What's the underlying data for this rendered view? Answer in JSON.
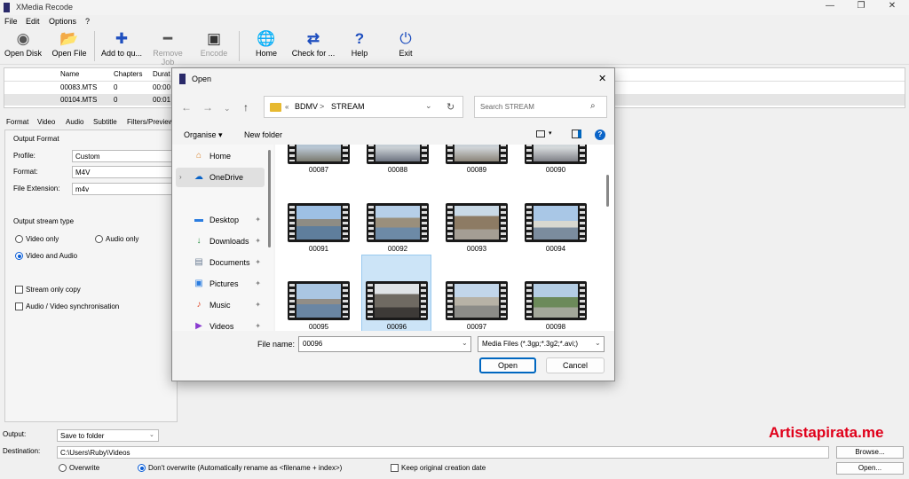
{
  "app": {
    "title": "XMedia Recode",
    "menu": [
      "File",
      "Edit",
      "Options",
      "?"
    ],
    "controls": {
      "minimize": "—",
      "maximize": "❐",
      "close": "✕"
    }
  },
  "toolbar": {
    "buttons": [
      {
        "label": "Open Disk",
        "icon": "disc-icon",
        "glyph": "◉",
        "enabled": true
      },
      {
        "label": "Open File",
        "icon": "folder-icon",
        "glyph": "📂",
        "enabled": true
      },
      {
        "label": "Add to qu...",
        "icon": "plus-icon",
        "glyph": "✚",
        "enabled": true
      },
      {
        "label": "Remove Job",
        "icon": "minus-icon",
        "glyph": "━",
        "enabled": false
      },
      {
        "label": "Encode",
        "icon": "encode-icon",
        "glyph": "▣",
        "enabled": false
      },
      {
        "label": "Home",
        "icon": "globe-icon",
        "glyph": "🌐",
        "enabled": true
      },
      {
        "label": "Check for ...",
        "icon": "refresh-icon",
        "glyph": "⇄",
        "enabled": true
      },
      {
        "label": "Help",
        "icon": "help-icon",
        "glyph": "?",
        "enabled": true
      },
      {
        "label": "Exit",
        "icon": "power-icon",
        "glyph": "⏻",
        "enabled": true
      }
    ]
  },
  "jobs": {
    "headers": [
      "Name",
      "Chapters",
      "Durat"
    ],
    "rows": [
      [
        "00083.MTS",
        "0",
        "00:00"
      ],
      [
        "00104.MTS",
        "0",
        "00:01"
      ]
    ]
  },
  "tabs": [
    "Format",
    "Video",
    "Audio",
    "Subtitle",
    "Filters/Preview"
  ],
  "format": {
    "group_title": "Output Format",
    "profile_label": "Profile:",
    "profile_value": "Custom",
    "format_label": "Format:",
    "format_value": "M4V",
    "ext_label": "File Extension:",
    "ext_value": "m4v",
    "stream_type_title": "Output stream type",
    "video_only": "Video only",
    "audio_only": "Audio only",
    "video_and_audio": "Video and Audio",
    "stream_copy": "Stream only copy",
    "av_sync": "Audio / Video synchronisation"
  },
  "bottom": {
    "output_label": "Output:",
    "output_value": "Save to folder",
    "destination_label": "Destination:",
    "destination_value": "C:\\Users\\Ruby\\Videos",
    "browse": "Browse...",
    "open": "Open...",
    "overwrite": "Overwrite",
    "dont_overwrite": "Don't overwrite (Automatically rename as <filename + index>)",
    "keep_date": "Keep original creation date"
  },
  "dialog": {
    "title": "Open",
    "close": "✕",
    "path": [
      "«",
      "BDMV",
      ">",
      "STREAM"
    ],
    "search_placeholder": "Search STREAM",
    "organise": "Organise ▾",
    "new_folder": "New folder",
    "nav": [
      {
        "label": "Home",
        "icon": "home-icon",
        "glyph": "⌂",
        "pin": false,
        "color": "#d9822b"
      },
      {
        "label": "OneDrive",
        "icon": "cloud-icon",
        "glyph": "☁",
        "pin": false,
        "color": "#0a64c8"
      },
      {
        "label": "Desktop",
        "icon": "desktop-icon",
        "glyph": "▬",
        "pin": true,
        "color": "#2b7de0"
      },
      {
        "label": "Downloads",
        "icon": "download-icon",
        "glyph": "↓",
        "pin": true,
        "color": "#1e8a3b"
      },
      {
        "label": "Documents",
        "icon": "documents-icon",
        "glyph": "▤",
        "pin": true,
        "color": "#6b7c93"
      },
      {
        "label": "Pictures",
        "icon": "pictures-icon",
        "glyph": "▣",
        "pin": true,
        "color": "#2b7de0"
      },
      {
        "label": "Music",
        "icon": "music-icon",
        "glyph": "♪",
        "pin": true,
        "color": "#e04a2b"
      },
      {
        "label": "Videos",
        "icon": "videos-icon",
        "glyph": "▶",
        "pin": true,
        "color": "#8a3bd0"
      }
    ],
    "files": [
      "00087",
      "00088",
      "00089",
      "00090",
      "00091",
      "00092",
      "00093",
      "00094",
      "00095",
      "00096",
      "00097",
      "00098"
    ],
    "selected_file": "00096",
    "file_name_label": "File name:",
    "file_name_value": "00096",
    "file_type": "Media Files (*.3gp;*.3g2;*.avi;)",
    "open_button": "Open",
    "cancel_button": "Cancel"
  },
  "watermark": "Artistapirata.me"
}
